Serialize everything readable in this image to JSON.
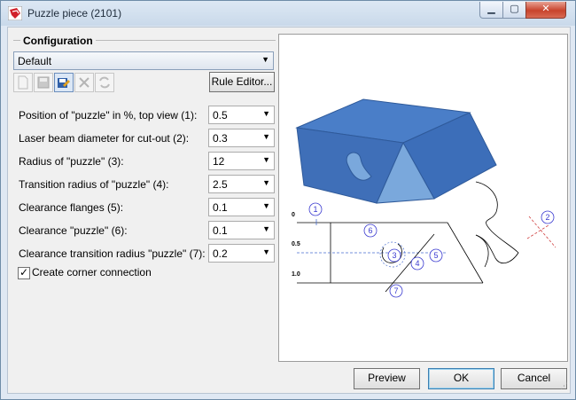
{
  "window": {
    "title": "Puzzle piece (2101)",
    "min_icon": "minimize-icon",
    "max_icon": "maximize-icon",
    "close_icon": "close-icon"
  },
  "configuration": {
    "group_title": "Configuration",
    "selected": "Default",
    "rule_editor_label": "Rule Editor..."
  },
  "params": [
    {
      "label": "Position of \"puzzle\" in %, top view  (1):",
      "value": "0.5"
    },
    {
      "label": "Laser beam diameter for cut-out  (2):",
      "value": "0.3"
    },
    {
      "label": "Radius of \"puzzle\"  (3):",
      "value": "12"
    },
    {
      "label": "Transition radius of \"puzzle\"  (4):",
      "value": "2.5"
    },
    {
      "label": "Clearance flanges  (5):",
      "value": "0.1"
    },
    {
      "label": "Clearance \"puzzle\"  (6):",
      "value": "0.1"
    },
    {
      "label": "Clearance transition radius \"puzzle\"  (7):",
      "value": "0.2"
    }
  ],
  "corner_connection": {
    "label": "Create corner connection",
    "checked": true
  },
  "preview": {
    "callouts": [
      "1",
      "2",
      "3",
      "4",
      "5",
      "6",
      "7"
    ],
    "scale_labels": [
      "0",
      "0.5",
      "1.0"
    ],
    "colors": {
      "face_dark": "#3f6fb8",
      "face_light": "#5b8fd6",
      "face_top": "#4a7ec8",
      "notch": "#7aa8dc",
      "callout": "#3a3ad0"
    }
  },
  "buttons": {
    "preview": "Preview",
    "ok": "OK",
    "cancel": "Cancel"
  }
}
